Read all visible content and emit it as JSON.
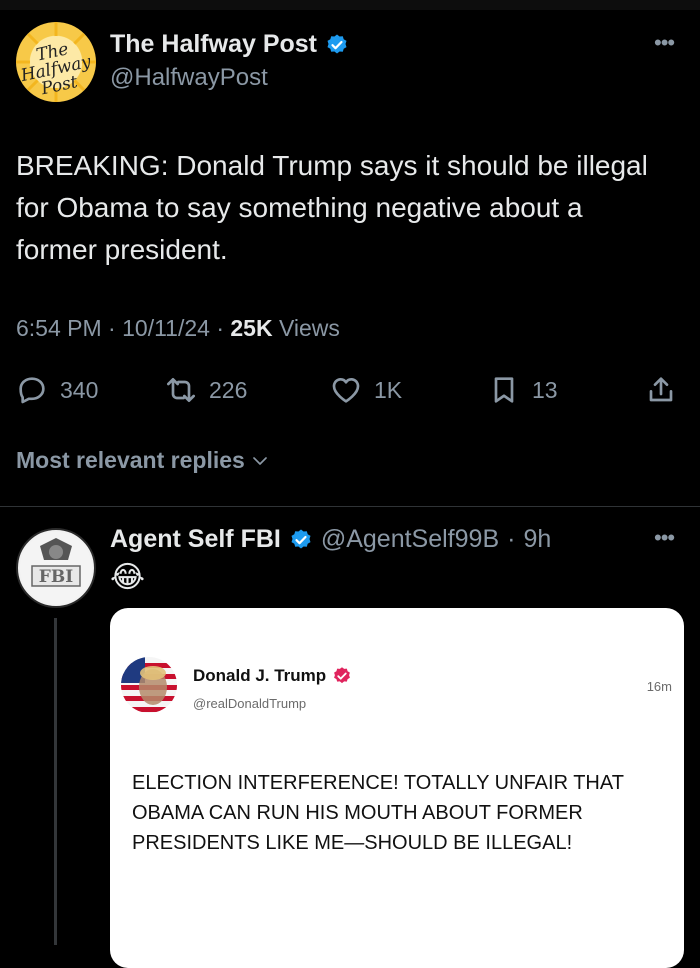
{
  "post": {
    "display_name": "The Halfway Post",
    "handle": "@HalfwayPost",
    "avatar_text": "The Halfway Post",
    "text": "BREAKING: Donald Trump says it should be illegal for Obama to say something negative about a former president.",
    "time": "6:54 PM",
    "date": "10/11/24",
    "views_count": "25K",
    "views_label": "Views",
    "stats": {
      "replies": "340",
      "reposts": "226",
      "likes": "1K",
      "bookmarks": "13"
    },
    "replies_sort_label": "Most relevant replies"
  },
  "reply": {
    "display_name": "Agent Self FBI",
    "handle": "@AgentSelf99B",
    "age": "9h",
    "emoji": "😂",
    "avatar_text": "FBI"
  },
  "embedded": {
    "display_name": "Donald J. Trump",
    "handle": "@realDonaldTrump",
    "time": "16m",
    "text": "ELECTION INTERFERENCE! TOTALLY UNFAIR THAT OBAMA CAN RUN HIS MOUTH ABOUT FORMER PRESIDENTS LIKE ME—SHOULD BE ILLEGAL!"
  },
  "colors": {
    "background": "#000000",
    "verified_blue": "#1d9bf0",
    "verified_red": "#e0245e",
    "secondary_text": "#8b98a5"
  }
}
